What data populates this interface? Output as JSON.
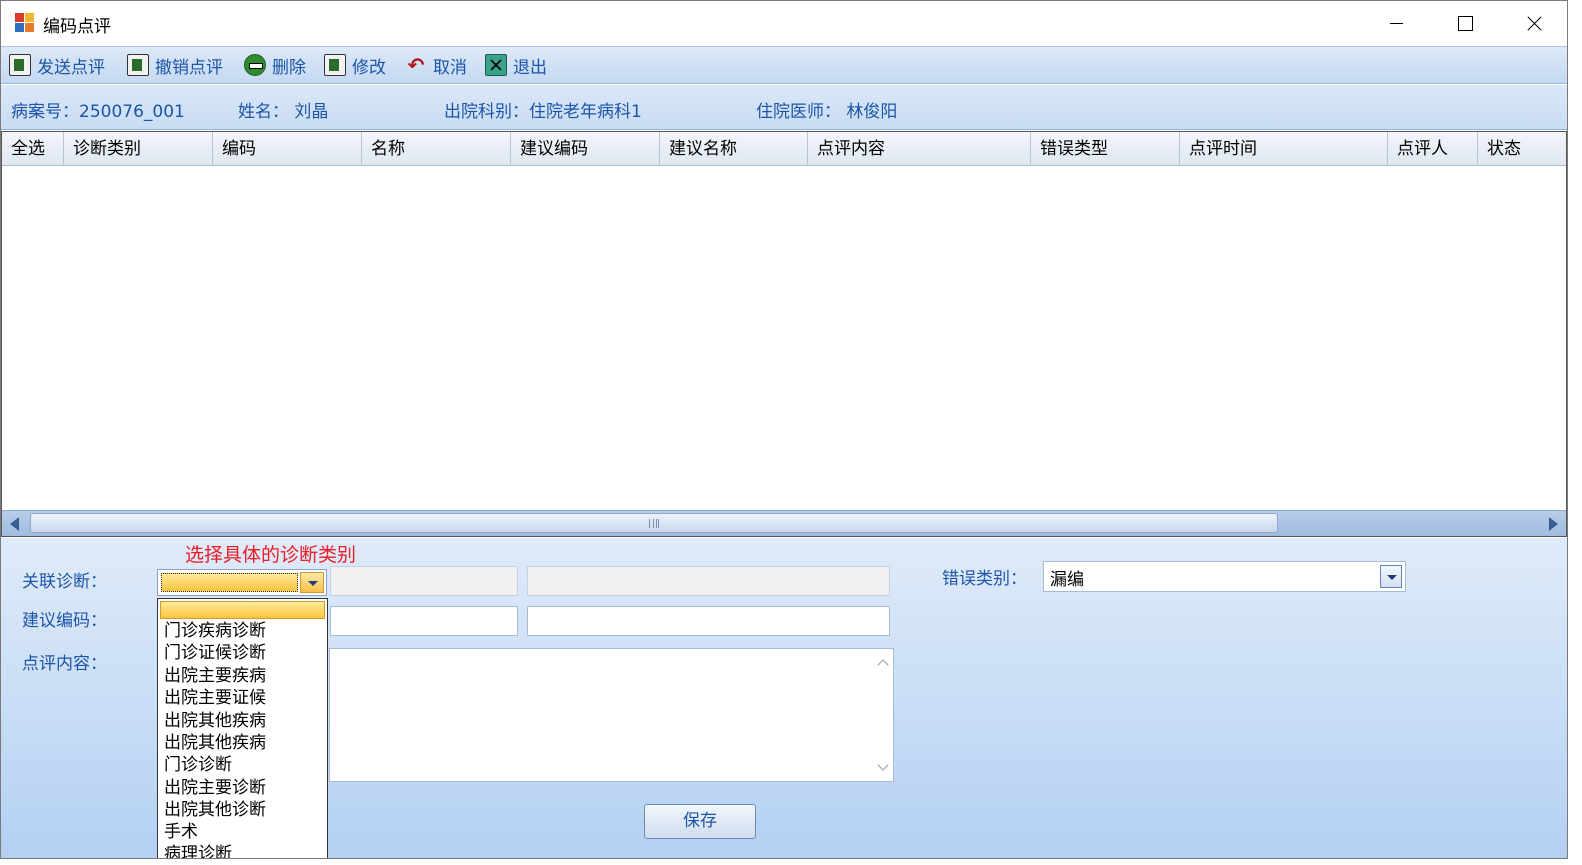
{
  "window": {
    "title": "编码点评"
  },
  "toolbar": {
    "send": "发送点评",
    "revoke": "撤销点评",
    "delete": "删除",
    "modify": "修改",
    "cancel": "取消",
    "exit": "退出"
  },
  "info": {
    "case_no": "病案号：250076_001",
    "name": "姓名：  刘晶",
    "dept": "出院科别：住院老年病科1",
    "doctor": "住院医师：  林俊阳"
  },
  "grid": {
    "columns": [
      "全选",
      "诊断类别",
      "编码",
      "名称",
      "建议编码",
      "建议名称",
      "点评内容",
      "错误类型",
      "点评时间",
      "点评人",
      "状态"
    ],
    "rows": []
  },
  "form": {
    "annotation": "选择具体的诊断类别",
    "related_label": "关联诊断：",
    "suggest_label": "建议编码：",
    "comment_label": "点评内容：",
    "error_label": "错误类别：",
    "error_value": "漏编",
    "save": "保存",
    "dropdown_options": [
      "门诊疾病诊断",
      "门诊证候诊断",
      "出院主要疾病",
      "出院主要证候",
      "出院其他疾病",
      "出院其他疾病",
      "门诊诊断",
      "出院主要诊断",
      "出院其他诊断",
      "手术",
      "病理诊断"
    ]
  }
}
